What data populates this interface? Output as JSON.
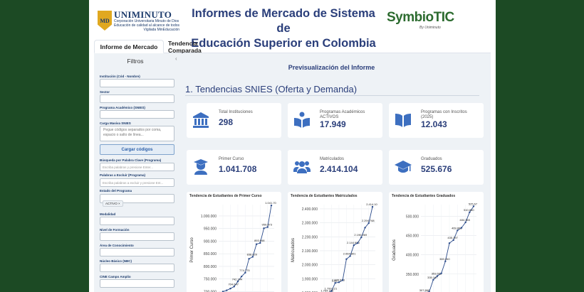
{
  "header": {
    "logo_left": {
      "name": "UNIMINUTO",
      "line1": "Corporación Universitaria Minuto de Dios",
      "line2": "Educación de calidad al alcance de todos",
      "line3": "Vigilada MinEducación"
    },
    "title_line1": "Informes de Mercado de Sistema de",
    "title_line2": "Educación Superior en Colombia",
    "logo_right": {
      "name": "SymbioTIC",
      "by": "By Uniminuto"
    }
  },
  "tabs": [
    {
      "label": "Informe de Mercado"
    },
    {
      "label": "Tendencia Comparada"
    }
  ],
  "sidebar": {
    "title": "Filtros",
    "collapse_icon": "chevron-left-icon",
    "fields": {
      "institucion": {
        "label": "Institución (Cód - Nombre)",
        "value": ""
      },
      "sector": {
        "label": "Sector",
        "value": ""
      },
      "programa": {
        "label": "Programa Académico (SNIES)",
        "value": ""
      },
      "carga_masiva": {
        "label": "Carga Masiva SNIES",
        "placeholder": "Pegue códigos separados por coma, espacio o salto de línea..."
      },
      "cargar_button": "Cargar códigos",
      "busqueda": {
        "label": "Búsqueda por Palabra Clave (Programa)",
        "placeholder": "Escriba palabras y presione Enter..."
      },
      "excluir": {
        "label": "Palabras a Excluir (Programa)",
        "placeholder": "Escriba palabras a excluir y presione Ent..."
      },
      "estado": {
        "label": "Estado del Programa",
        "chip": "ACTIVO ×"
      },
      "modalidad": {
        "label": "Modalidad",
        "value": ""
      },
      "nivel": {
        "label": "Nivel de Formación",
        "value": ""
      },
      "area": {
        "label": "Área de Conocimiento",
        "value": ""
      },
      "nbc": {
        "label": "Núcleo Básico (NBC)",
        "value": ""
      },
      "cine": {
        "label": "CINE Campo Amplio",
        "value": ""
      }
    }
  },
  "main": {
    "preview_title": "Previsualización del Informe",
    "section_title": "1. Tendencias SNIES (Oferta y Demanda)",
    "cards": [
      {
        "label": "Total Instituciones",
        "value": "298",
        "icon": "institution-icon"
      },
      {
        "label": "Programas Académicos ACTIVOS",
        "value": "17.949",
        "icon": "book-reader-icon"
      },
      {
        "label": "Programas con Inscritos (2025)",
        "value": "12.043",
        "icon": "open-book-icon"
      },
      {
        "label": "Primer Curso",
        "value": "1.041.708",
        "icon": "graduate-user-icon"
      },
      {
        "label": "Matriculados",
        "value": "2.414.104",
        "icon": "users-icon"
      },
      {
        "label": "Graduados",
        "value": "525.676",
        "icon": "graduation-cap-icon"
      }
    ]
  },
  "chart_data": [
    {
      "type": "line",
      "title": "Tendencia de Estudiantes de Primer Curso",
      "ylabel": "Primer Curso",
      "yticks": [
        "1.000.000",
        "950.000",
        "900.000",
        "850.000",
        "800.000",
        "750.000",
        "700.000"
      ],
      "ylim": [
        690000,
        1045000
      ],
      "values": [
        700000,
        705000,
        712000,
        720000,
        740000,
        760000,
        775000,
        830000,
        838000,
        888000,
        893000,
        951000,
        956000,
        1041708
      ],
      "data_labels": [
        "",
        "",
        "",
        "704.647",
        "742.244",
        "",
        "774.775",
        "",
        "838.820",
        "",
        "893.948",
        "",
        "959.873",
        "1.041.70"
      ],
      "color": "#2a4a8a"
    },
    {
      "type": "line",
      "title": "Tendencia de Estudiantes Matriculados",
      "ylabel": "Matriculados",
      "yticks": [
        "2.400.000",
        "2.300.000",
        "2.200.000",
        "2.100.000",
        "2.000.000",
        "1.900.000",
        "1.800.000"
      ],
      "ylim": [
        1790000,
        2430000
      ],
      "values": [
        1794000,
        1797000,
        1812000,
        1870000,
        1875000,
        1890000,
        2040000,
        2062000,
        2140000,
        2155000,
        2196000,
        2265000,
        2298000,
        2414104
      ],
      "data_labels": [
        "",
        "1.764.153",
        "1.799.121",
        "1.88",
        "1.878.633",
        "",
        "",
        "2.064.801",
        "2.144.983",
        "",
        "2.196.969",
        "",
        "2.294.768",
        "2.414.10"
      ],
      "color": "#2a4a8a"
    },
    {
      "type": "line",
      "title": "Tendencia de Estudiantes Graduados",
      "ylabel": "Graduados",
      "yticks": [
        "500.000",
        "450.000",
        "400.000",
        "350.000",
        "300.000"
      ],
      "ylim": [
        298000,
        530000
      ],
      "values": [
        302000,
        304000,
        335000,
        345000,
        352000,
        383000,
        430000,
        438000,
        463000,
        470000,
        484000,
        510000,
        525676
      ],
      "data_labels": [
        "307.868",
        "",
        "335.167",
        "353.552",
        "",
        "383.260",
        "",
        "435.397",
        "469.865",
        "",
        "484.365",
        "510.850",
        "525.67"
      ],
      "color": "#2a4a8a"
    }
  ]
}
